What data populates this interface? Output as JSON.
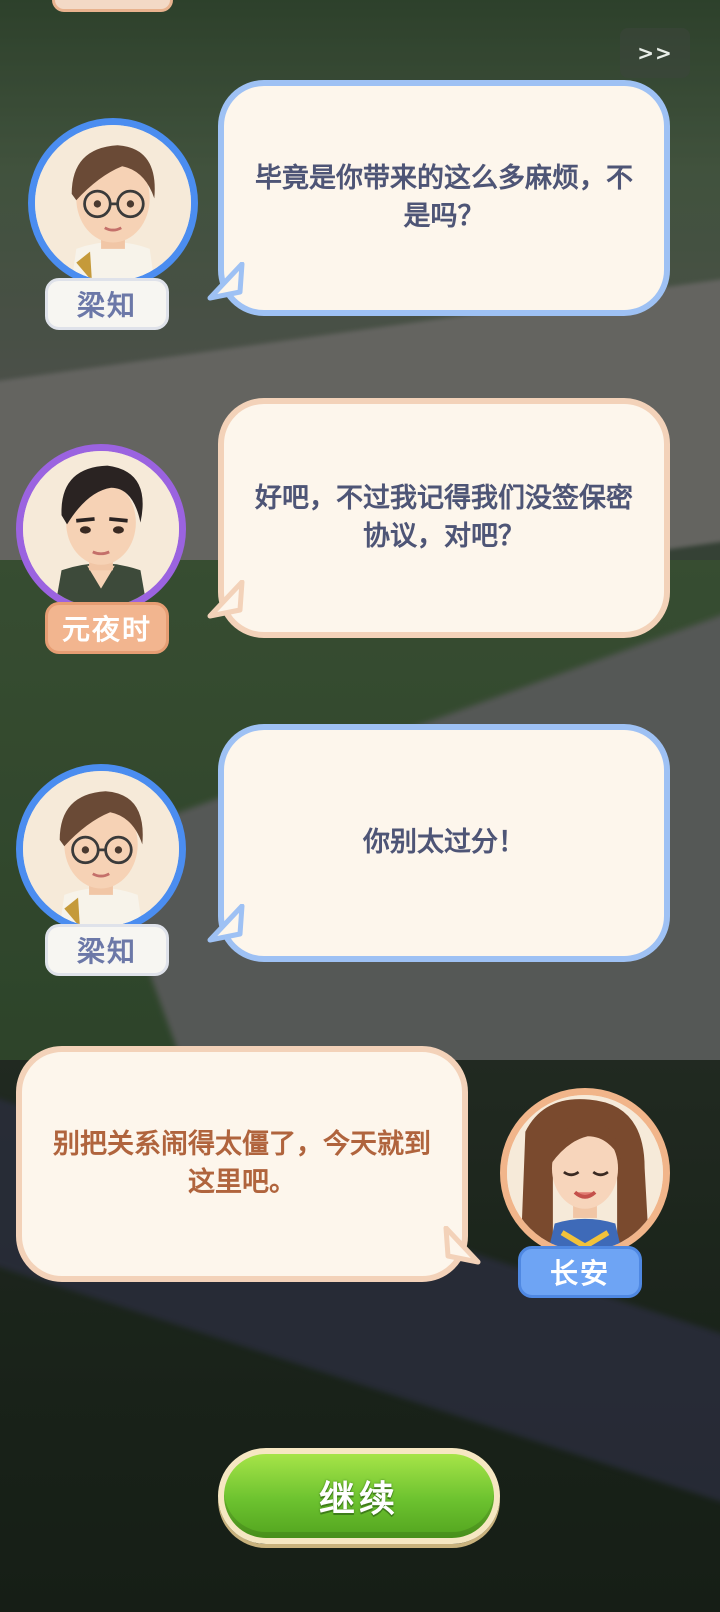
{
  "skip_label": ">>",
  "continue_label": "继续",
  "dialogues": [
    {
      "speaker": "梁知",
      "text": "毕竟是你带来的这么多麻烦，不是吗？"
    },
    {
      "speaker": "元夜时",
      "text": "好吧，不过我记得我们没签保密协议，对吧？"
    },
    {
      "speaker": "梁知",
      "text": "你别太过分！"
    },
    {
      "speaker": "长安",
      "text": "别把关系闹得太僵了，今天就到这里吧。"
    }
  ],
  "colors": {
    "bubble_border_blue": "#9ec1f4",
    "bubble_border_peach": "#f3d2b9",
    "continue_green": "#6cc22f"
  }
}
